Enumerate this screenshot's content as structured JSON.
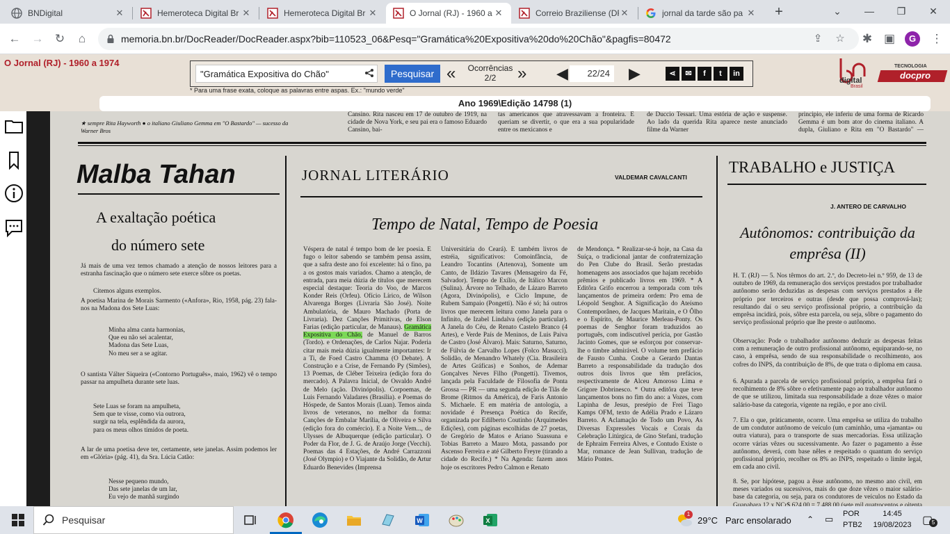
{
  "tabs": [
    {
      "title": "BNDigital",
      "favicon": "globe-icon",
      "active": false
    },
    {
      "title": "Hemeroteca Digital Br",
      "favicon": "bn-icon",
      "active": false
    },
    {
      "title": "Hemeroteca Digital Br",
      "favicon": "bn-icon",
      "active": false
    },
    {
      "title": "O Jornal (RJ) - 1960 a",
      "favicon": "bn-icon",
      "active": true
    },
    {
      "title": "Correio Braziliense (DF",
      "favicon": "bn-icon",
      "active": false
    },
    {
      "title": "jornal da tarde são pa",
      "favicon": "google-icon",
      "active": false
    }
  ],
  "toolbar": {
    "url": "memoria.bn.br/DocReader/DocReader.aspx?bib=110523_06&Pesq=\"Gramática%20Expositiva%20do%20Chão\"&pagfis=80472",
    "avatar_letter": "G"
  },
  "reader": {
    "collection_title": "O Jornal (RJ) - 1960 a 1974",
    "search_value": "\"Gramática Expositiva do Chão\"",
    "search_button": "Pesquisar",
    "occurrences_label": "Ocorrências",
    "occurrences_value": "2/2",
    "page_value": "22/24",
    "hint": "* Para uma frase exata, coloque as palavras entre aspas. Ex.: \"mundo verde\"",
    "edition": "Ano 1969\\Edição 14798 (1)",
    "logo_text": "digital",
    "logo_sub": "Brasil",
    "partner_top": "TECNOLOGIA",
    "partner_name": "docpro"
  },
  "newspaper": {
    "caption_left": "★ sempre Rita Hayworth ● o italiano Giuliano Gemma em \"O Bastardo\" — sucesso da Warner Bros",
    "top_snippet": "Cansino. Rita nasceu em 17 de outubro de 1919, na cidade de Nova York, e seu pai era o famoso Eduardo Cansino, bai-",
    "top_snippet2": "tas americanos que atravessavam a fronteira. E queriam se divertir, o que era a sua popularidade entre os mexicanos e",
    "top_snippet3": "de Duccio Tessari. Uma estória de ação e suspense. Ao lado da querida Rita aparece neste anunciado filme da Warner",
    "top_snippet4": "principio, ele inferiu de uma forma de Ricardo Gemma é um bom ator do cinema italiano. A dupla, Giuliano e Rita em \"O Bastardo\" — excelente.",
    "col1_headline": "Malba Tahan",
    "col1_sub1": "A exaltação poética",
    "col1_sub2": "do número sete",
    "col1_p1": "Já mais de uma vez temos chamado a atenção de nossos leitores para a estranha fascinação que o número sete exerce sôbre os poetas.",
    "col1_p2": "Citemos alguns exemplos.",
    "col1_p3": "A poetisa Marina de Morais Sarmento («Anfora», Rio, 1958, pág. 23) fala-nos na Madona dos Sete Luas:",
    "col1_v1": "Minha alma canta harmonias,\nQue eu não sei acalentar,\nMadona das Sete Luas,\nNo meu ser a se agitar.",
    "col1_p4": "O santista Válter Siqueira («Contorno Português», maio, 1962) vê o tempo passar na ampulheta durante sete luas.",
    "col1_v2": "Sete Luas se foram na ampulheta,\nSem que te visse, como via outrora,\nsurgir na tela, esplêndida da aurora,\npara os meus olhos tímidos de poeta.",
    "col1_p5": "A lar de uma poetisa deve ter, certamente, sete janelas. Assim podemos ler em «Glória» (pág. 41), da Sra. Lúcia Catão:",
    "col1_v3": "Nesse pequeno mundo,\nDas sete janelas de um lar,\nEu vejo de manhã surgindo",
    "col2_section": "JORNAL LITERÁRIO",
    "col2_byline": "VALDEMAR CAVALCANTI",
    "col2_headline": "Tempo de Natal, Tempo de Poesia",
    "col2_a_pre": "Véspera de natal é tempo bom de ler poesia. É fugo o leitor sabendo se também pensa assim, que a safra deste ano foi excelente: há o fino, pa a os gostos mais variados. Chamo a atenção, de entrada, para meia dúzia de títulos que merecem especial destaque: Teoria do Voo, de Marcos Konder Reis (Orfeu). Ofício Lírico, de Wilson Alvarenga Borges (Livraria São José). Noite Ambulatória, de Mauro Machado (Porta de Livraria). Dez Canções Primitivas, de Elson Farias (edição particular, de Manaus).",
    "col2_a_hl": "Gramática Expositiva do Chão,",
    "col2_a_post": "de Manuel de Barros (Tordo). e Ordenações, de Carlos Najar. Poderia citar mais meia dúzia igualmente importantes: Ir a Ti, de Foed Castro Chamma (O Debate). A Construção e a Crise, de Fernando Py (Simões), 13 Poemas, de Cléber Teixeira (edição fora do mercado). A Palavra Inicial, de Osvaldo André de Melo (ação. Divinópolis). Corpoemas, de Luis Fernando Valadares (Brasília). e Poemas do Hóspede, de Santos Morais (Luan). Temos ainda livros de veteranos, no melhor da forma: Canções de Embalar Marília, de Oliveira e Silva (edição fora do comércio). E a Noite Vem..., de Ulysses de Albuquerque (edição particular). O Poder da Flor, de J. G. de Araújo Jorge (Vecchi). Poemas das 4 Estações, de André Carrazzoni (José Olympio) e O Viajante da Solidão, de Artur Eduardo Benevides (Imprensa",
    "col2_b": "Universitária do Ceará). E também livros de estréia, significativos: Comoinfância, de Leandro Tocantins (Artenova), Somente um Canto, de Ildázio Tavares (Mensageiro da Fé, Salvador). Tempo de Exílio, de Itálico Marcon (Sulina). Árvore no Telhado, de Lázaro Barreto (Agora, Divinópolis), e Ciclo Impune, de Rubem Sampaio (Pongetti). Não é só; há outros livros que merecem leitura como Janela para o Infinito, de Izabel Lindalva (edição particular). A Janela do Céu, de Renato Castelo Branco (4 Artes), e Verde País de Meninos, de Luis Paiva de Castro (José Álvaro). Mais: Saturno, Saturno, de Fúlvia de Carvalho Lopes (Folco Masucci). Solidão, de Menandro Whately (Cia. Brasileira de Artes Gráficas) e Sonhos, de Ademar Gonçalves Neves Filho (Pongetti). Tivemos, lançada pela Faculdade de Filosofia de Ponta Grossa — PR — uma segunda edição de Tiãs de Brome (Ritmos da América), de Faris Antonio S. Michaele. E em matéria de antologia, a novidade é Presença Poética do Recife, organizada por Edilberto Coutinho (Arquimedes Edições), com páginas escolhidas de 27 poetas, de Gregório de Matos e Ariano Suassuna e Tobias Barreto a Mauro Mota, passando por Ascenso Ferreira e até Gilberto Freyre (tirando a cidade do Recife.) * Na Agenda: fazem anos hoje os escritores Pedro Calmon e Renato",
    "col2_c": "de Mendonça. * Realizar-se-á hoje, na Casa da Suíça, o tradicional jantar de confraternização do Pen Clube do Brasil. Serão prestadas homenagens aos associados que hajam recebido prêmios e publicado livros em 1969. * A Editôra Grifo encerrou a temporada com três lançamentos de primeira ordem: Pro ema de Léopold Senghor. A Significação do Ateísmo Contemporâneo, de Jacques Maritain, e O Ôlho e o Espírito, de Maurice Merleau-Ponty. Os poemas de Senghor foram traduzidos ao português, com indiscutível perícia, por Gastão Jacinto Gomes, que se esforçou por conservar-lhe o timbre admirável. O volume tem prefácio de Fausto Cunha. Coube a Gerardo Dantas Barreto a responsabilidade da tradução dos outros dois livros que têm prefácios, respectivamente de Alceu Amoroso Lima e Grigore Dobrinesco. * Outra editôra que teve lançamentos bons no fim do ano: a Vozes, com Lapinha de Jesus, presépio de Frei Tiago Kamps OFM, texto de Adélia Prado e Lázaro Barreto. A Aclamação de Todo um Povo, As Diversas Expressões Vocais e Corais da Celebração Litúrgica, de Gino Stefani, tradução de Ephraim Ferreira Alves, e Contudo Existe o Mar, romance de Jean Sullivan, tradução de Mário Pontes.",
    "col3_section": "TRABALHO e JUSTIÇA",
    "col3_byline": "J. ANTERO DE CARVALHO",
    "col3_headline": "Autônomos: contribuição da emprêsa (II)",
    "col3_p1": "H. T. (RJ) — 5. Nos têrmos do art. 2.º, do Decreto-lei n.º 959, de 13 de outubro de 1969, da remuneração dos serviços prestados por trabalhador autônomo serão deduzidas as despesas com serviços prestados a êle próprio por terceiros e outras (desde que possa comprová-las); resultando daí o seu serviço profissional próprio, a contribuição da emprêsa incidirá, pois, sôbre esta parcela, ou seja, sôbre o pagamento do serviço profissional próprio que lhe preste o autônomo.",
    "col3_p2": "Observação: Pode o trabalhador autônomo deduzir as despesas feitas com a remuneração de outro profissional autônomo, equiparando-se, no caso, à emprêsa, sendo de sua responsabilidade o recolhimento, aos cofres do INPS, da contribuição de 8%, de que trata o diploma em causa.",
    "col3_p3": "6. Apurada a parcela de serviço profissional próprio, a emprêsa fará o recolhimento de 8% sôbre o efetivamente pago ao trabalhador autônomo de que se utilizou, limitada sua responsabilidade a doze vêzes o maior salário-base da categoria, vigente na região, e por ano civil.",
    "col3_p4": "7. Ela o que, pràticamente, ocorre. Uma emprêsa se utiliza do trabalho de um condutor autônomo de veículo (um caminhão, uma «jamanta» ou outra viatura), para o transporte de suas mercadorias. Essa utilização ocorre várias vêzes ou sucessivamente. Ao fazer o pagamento a êsse autônomo, deverá, com base nêles e respeitado o quantum do serviço profissional próprio, recolher os 8% ao INPS, respeitado o limite legal, em cada ano civil.",
    "col3_p5": "8. Se, por hipótese, pagou a êsse autônomo, no mesmo ano civil, em meses variados ou sucessivos, mais do que doze vêzes o maior salário-base da categoria, ou seja, para os condutores de veículos no Estado da Guanabara 12 x NCr$ 624,00 = 7.488,00 (sete mil quatrocentos e oitenta e oito"
  },
  "taskbar": {
    "search_placeholder": "Pesquisar",
    "weather_temp": "29°C",
    "weather_text": "Parc ensolarado",
    "lang1": "POR",
    "lang2": "PTB2",
    "time": "14:45",
    "date": "19/08/2023",
    "notifications": "5",
    "weather_badge": "1"
  },
  "colors": {
    "accent_blue": "#2f6ccc",
    "brand_red": "#b0202a",
    "highlight_green": "#7cd957"
  }
}
